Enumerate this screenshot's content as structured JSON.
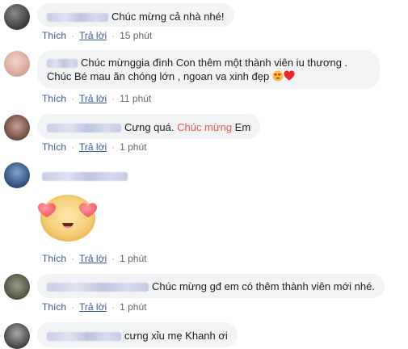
{
  "comments": [
    {
      "text": "Chúc mừng cả nhà nhé!",
      "actions": {
        "like": "Thích",
        "reply": "Trả lời",
        "time": "15 phút"
      }
    },
    {
      "text": "Chúc mừnggia đình Con thêm một thành viên iu thương . Chúc Bé mau ăn chóng lớn , ngoan va xinh đẹp",
      "emojis": [
        "heart-eyes-emoji",
        "red-heart-emoji"
      ],
      "actions": {
        "like": "Thích",
        "reply": "Trả lời",
        "time": "11 phút"
      }
    },
    {
      "text_before": "Cưng quá.",
      "highlight": "Chúc mừng",
      "text_after": "Em",
      "highlight_color": "#e9594f",
      "actions": {
        "like": "Thích",
        "reply": "Trả lời",
        "time": "1 phút"
      }
    },
    {
      "sticker": "heart-eyes-sticker",
      "actions": {
        "like": "Thích",
        "reply": "Trả lời",
        "time": "1 phút"
      }
    },
    {
      "text": "Chúc mừng gđ em có thêm thành viên mới nhé.",
      "actions": {
        "like": "Thích",
        "reply": "Trả lời",
        "time": "1 phút"
      }
    },
    {
      "text": "cưng xỉu mẹ Khanh ơi"
    }
  ],
  "colors": {
    "link": "#385898",
    "bubble": "#f2f3f5",
    "separator": "#90949c"
  }
}
